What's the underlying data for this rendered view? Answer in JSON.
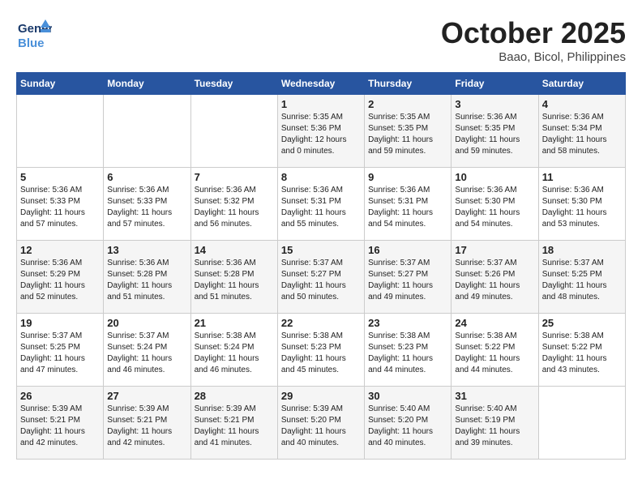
{
  "header": {
    "logo_general": "General",
    "logo_blue": "Blue",
    "month": "October 2025",
    "location": "Baao, Bicol, Philippines"
  },
  "weekdays": [
    "Sunday",
    "Monday",
    "Tuesday",
    "Wednesday",
    "Thursday",
    "Friday",
    "Saturday"
  ],
  "weeks": [
    [
      {
        "day": "",
        "info": ""
      },
      {
        "day": "",
        "info": ""
      },
      {
        "day": "",
        "info": ""
      },
      {
        "day": "1",
        "info": "Sunrise: 5:35 AM\nSunset: 5:36 PM\nDaylight: 12 hours\nand 0 minutes."
      },
      {
        "day": "2",
        "info": "Sunrise: 5:35 AM\nSunset: 5:35 PM\nDaylight: 11 hours\nand 59 minutes."
      },
      {
        "day": "3",
        "info": "Sunrise: 5:36 AM\nSunset: 5:35 PM\nDaylight: 11 hours\nand 59 minutes."
      },
      {
        "day": "4",
        "info": "Sunrise: 5:36 AM\nSunset: 5:34 PM\nDaylight: 11 hours\nand 58 minutes."
      }
    ],
    [
      {
        "day": "5",
        "info": "Sunrise: 5:36 AM\nSunset: 5:33 PM\nDaylight: 11 hours\nand 57 minutes."
      },
      {
        "day": "6",
        "info": "Sunrise: 5:36 AM\nSunset: 5:33 PM\nDaylight: 11 hours\nand 57 minutes."
      },
      {
        "day": "7",
        "info": "Sunrise: 5:36 AM\nSunset: 5:32 PM\nDaylight: 11 hours\nand 56 minutes."
      },
      {
        "day": "8",
        "info": "Sunrise: 5:36 AM\nSunset: 5:31 PM\nDaylight: 11 hours\nand 55 minutes."
      },
      {
        "day": "9",
        "info": "Sunrise: 5:36 AM\nSunset: 5:31 PM\nDaylight: 11 hours\nand 54 minutes."
      },
      {
        "day": "10",
        "info": "Sunrise: 5:36 AM\nSunset: 5:30 PM\nDaylight: 11 hours\nand 54 minutes."
      },
      {
        "day": "11",
        "info": "Sunrise: 5:36 AM\nSunset: 5:30 PM\nDaylight: 11 hours\nand 53 minutes."
      }
    ],
    [
      {
        "day": "12",
        "info": "Sunrise: 5:36 AM\nSunset: 5:29 PM\nDaylight: 11 hours\nand 52 minutes."
      },
      {
        "day": "13",
        "info": "Sunrise: 5:36 AM\nSunset: 5:28 PM\nDaylight: 11 hours\nand 51 minutes."
      },
      {
        "day": "14",
        "info": "Sunrise: 5:36 AM\nSunset: 5:28 PM\nDaylight: 11 hours\nand 51 minutes."
      },
      {
        "day": "15",
        "info": "Sunrise: 5:37 AM\nSunset: 5:27 PM\nDaylight: 11 hours\nand 50 minutes."
      },
      {
        "day": "16",
        "info": "Sunrise: 5:37 AM\nSunset: 5:27 PM\nDaylight: 11 hours\nand 49 minutes."
      },
      {
        "day": "17",
        "info": "Sunrise: 5:37 AM\nSunset: 5:26 PM\nDaylight: 11 hours\nand 49 minutes."
      },
      {
        "day": "18",
        "info": "Sunrise: 5:37 AM\nSunset: 5:25 PM\nDaylight: 11 hours\nand 48 minutes."
      }
    ],
    [
      {
        "day": "19",
        "info": "Sunrise: 5:37 AM\nSunset: 5:25 PM\nDaylight: 11 hours\nand 47 minutes."
      },
      {
        "day": "20",
        "info": "Sunrise: 5:37 AM\nSunset: 5:24 PM\nDaylight: 11 hours\nand 46 minutes."
      },
      {
        "day": "21",
        "info": "Sunrise: 5:38 AM\nSunset: 5:24 PM\nDaylight: 11 hours\nand 46 minutes."
      },
      {
        "day": "22",
        "info": "Sunrise: 5:38 AM\nSunset: 5:23 PM\nDaylight: 11 hours\nand 45 minutes."
      },
      {
        "day": "23",
        "info": "Sunrise: 5:38 AM\nSunset: 5:23 PM\nDaylight: 11 hours\nand 44 minutes."
      },
      {
        "day": "24",
        "info": "Sunrise: 5:38 AM\nSunset: 5:22 PM\nDaylight: 11 hours\nand 44 minutes."
      },
      {
        "day": "25",
        "info": "Sunrise: 5:38 AM\nSunset: 5:22 PM\nDaylight: 11 hours\nand 43 minutes."
      }
    ],
    [
      {
        "day": "26",
        "info": "Sunrise: 5:39 AM\nSunset: 5:21 PM\nDaylight: 11 hours\nand 42 minutes."
      },
      {
        "day": "27",
        "info": "Sunrise: 5:39 AM\nSunset: 5:21 PM\nDaylight: 11 hours\nand 42 minutes."
      },
      {
        "day": "28",
        "info": "Sunrise: 5:39 AM\nSunset: 5:21 PM\nDaylight: 11 hours\nand 41 minutes."
      },
      {
        "day": "29",
        "info": "Sunrise: 5:39 AM\nSunset: 5:20 PM\nDaylight: 11 hours\nand 40 minutes."
      },
      {
        "day": "30",
        "info": "Sunrise: 5:40 AM\nSunset: 5:20 PM\nDaylight: 11 hours\nand 40 minutes."
      },
      {
        "day": "31",
        "info": "Sunrise: 5:40 AM\nSunset: 5:19 PM\nDaylight: 11 hours\nand 39 minutes."
      },
      {
        "day": "",
        "info": ""
      }
    ]
  ]
}
